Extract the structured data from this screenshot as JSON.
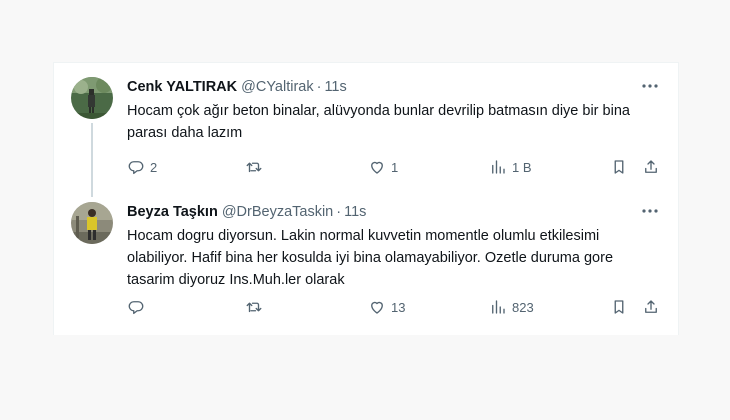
{
  "colors": {
    "text": "#0f1419",
    "muted": "#536471",
    "border": "#eff3f4",
    "thread": "#cfd9de"
  },
  "tweets": [
    {
      "name": "Cenk YALTIRAK",
      "handle": "@CYaltirak",
      "separator": "·",
      "time": "11s",
      "text": "Hocam çok ağır beton binalar, alüvyonda bunlar devrilip batmasın diye bir bina parası daha lazım",
      "replies": "2",
      "retweets": "",
      "likes": "1",
      "views": "1 B",
      "icons": [
        "reply-icon",
        "retweet-icon",
        "like-icon",
        "views-icon",
        "bookmark-icon",
        "share-icon"
      ]
    },
    {
      "name": "Beyza Taşkın",
      "handle": "@DrBeyzaTaskin",
      "separator": "·",
      "time": "11s",
      "text": "Hocam dogru diyorsun. Lakin normal kuvvetin momentle olumlu etkilesimi olabiliyor. Hafif bina her kosulda iyi bina olamayabiliyor. Ozetle duruma gore tasarim diyoruz Ins.Muh.ler olarak",
      "replies": "",
      "retweets": "",
      "likes": "13",
      "views": "823",
      "icons": [
        "reply-icon",
        "retweet-icon",
        "like-icon",
        "views-icon",
        "bookmark-icon",
        "share-icon"
      ]
    }
  ]
}
